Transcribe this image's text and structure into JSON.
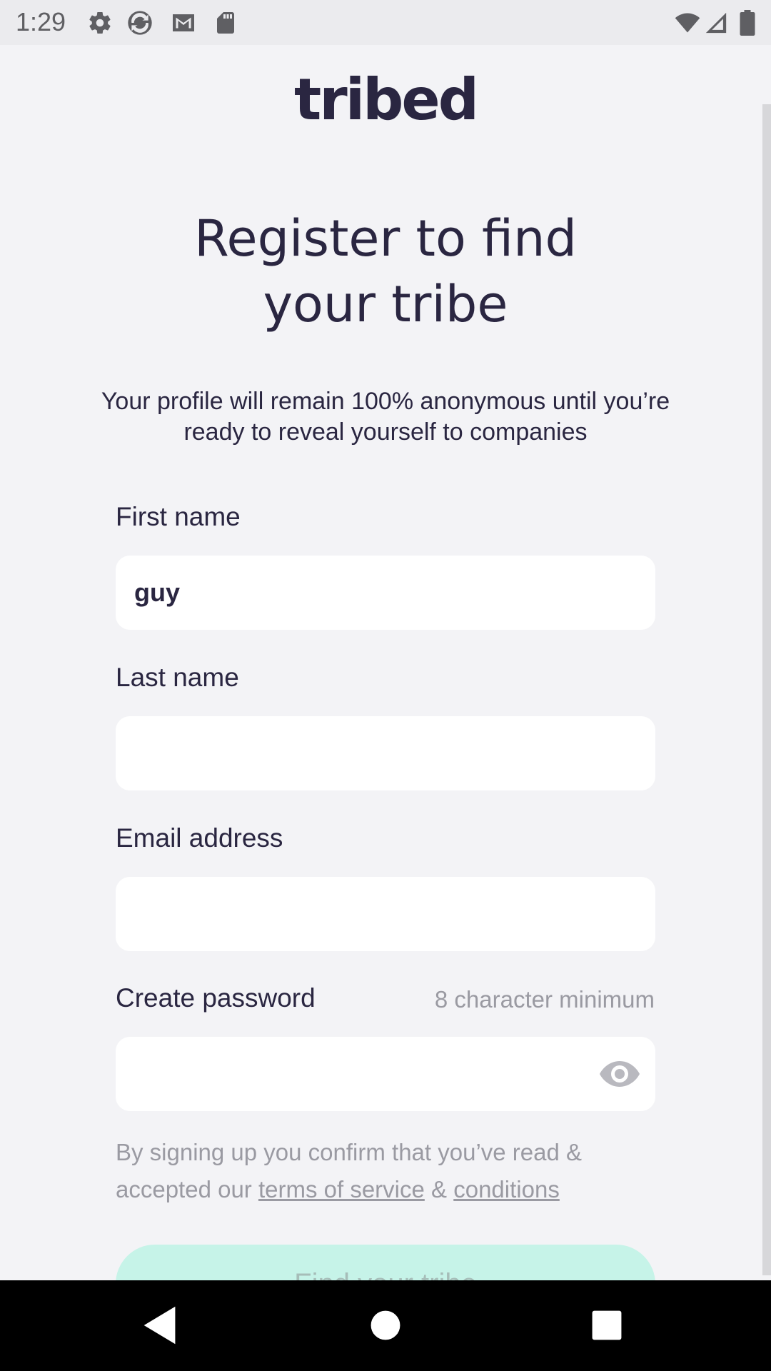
{
  "status_bar": {
    "time": "1:29",
    "icons": [
      "settings-icon",
      "sync-icon",
      "gmail-icon",
      "sd-card-icon"
    ],
    "right_icons": [
      "wifi-icon",
      "signal-icon",
      "battery-icon"
    ]
  },
  "app": {
    "logo": "tribed",
    "heading_line1": "Register to find",
    "heading_line2": "your tribe",
    "subtitle": "Your profile will remain 100% anonymous until you’re ready to reveal yourself to companies"
  },
  "form": {
    "first_name": {
      "label": "First name",
      "value": "guy"
    },
    "last_name": {
      "label": "Last name",
      "value": ""
    },
    "email": {
      "label": "Email address",
      "value": ""
    },
    "password": {
      "label": "Create password",
      "hint": "8 character minimum",
      "value": ""
    }
  },
  "legal": {
    "text_before": "By signing up you confirm that you’ve read & accepted our ",
    "terms_link": "terms of service",
    "amp": " & ",
    "conditions_link": "conditions"
  },
  "cta": {
    "label": "Find your tribe"
  },
  "colors": {
    "primary_text": "#2a2641",
    "muted_text": "#9a9aa2",
    "background": "#f3f3f6",
    "cta_background": "#c6f3e8"
  }
}
